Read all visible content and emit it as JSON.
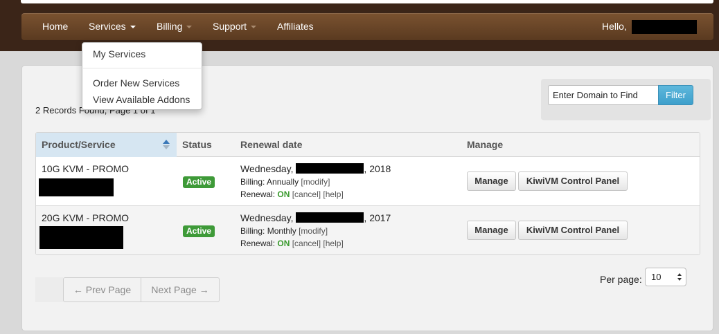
{
  "nav": {
    "home": "Home",
    "services": "Services",
    "billing": "Billing",
    "support": "Support",
    "affiliates": "Affiliates",
    "hello": "Hello,"
  },
  "services_menu": {
    "items": [
      "My Services",
      "Order New Services",
      "View Available Addons"
    ]
  },
  "records_text": "2 Records Found, Page 1 of 1",
  "filter": {
    "placeholder": "Enter Domain to Find",
    "button": "Filter"
  },
  "table": {
    "columns": [
      "Product/Service",
      "Status",
      "Renewal date",
      "Manage"
    ],
    "rows": [
      {
        "product": "10G KVM - PROMO",
        "status": "Active",
        "renewal_day": "Wednesday,",
        "renewal_year": ", 2018",
        "billing_label": "Billing:",
        "billing_cycle": "Annually",
        "modify": "[modify]",
        "renewal_label": "Renewal:",
        "renewal_state": "ON",
        "cancel": "[cancel]",
        "help": "[help]",
        "manage_btn": "Manage",
        "panel_btn": "KiwiVM Control Panel"
      },
      {
        "product": "20G KVM - PROMO",
        "status": "Active",
        "renewal_day": "Wednesday,",
        "renewal_year": ", 2017",
        "billing_label": "Billing:",
        "billing_cycle": "Monthly",
        "modify": "[modify]",
        "renewal_label": "Renewal:",
        "renewal_state": "ON",
        "cancel": "[cancel]",
        "help": "[help]",
        "manage_btn": "Manage",
        "panel_btn": "KiwiVM Control Panel"
      }
    ]
  },
  "pagination": {
    "prev": "← Prev Page",
    "next": "Next Page →",
    "per_page_label": "Per page:",
    "per_page_value": "10"
  },
  "colors": {
    "navbar": "#6b4628",
    "active_badge": "#3e9a38",
    "filter_button": "#4aa9d3"
  }
}
